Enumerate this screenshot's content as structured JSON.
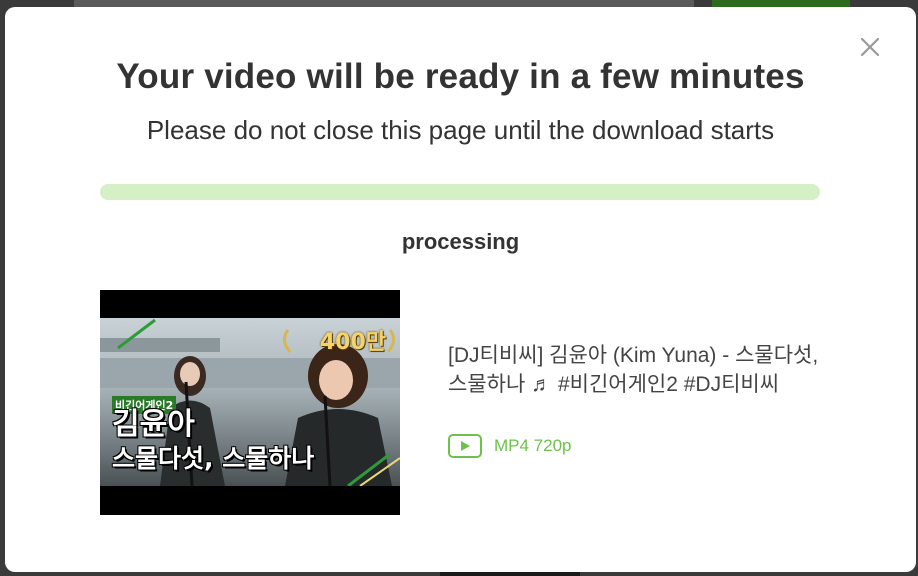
{
  "modal": {
    "title": "Your video will be ready in a few minutes",
    "subtitle": "Please do not close this page until the download starts",
    "status": "processing",
    "close_icon": "close-icon"
  },
  "progress": {
    "fraction": 0.0
  },
  "video": {
    "title": "[DJ티비씨] 김윤아 (Kim Yuna) - 스물다섯, 스물하나 ♬ #비긴어게인2 #DJ티비씨",
    "format": "MP4 720p",
    "thumbnail": {
      "badge": "400만",
      "tag": "비긴어게인2",
      "name": "김윤아",
      "song": "스물다섯, 스물하나"
    }
  },
  "colors": {
    "accent": "#6cc24a",
    "progress_track": "#d5f0c7",
    "text": "#333333"
  },
  "icons": [
    "close-icon",
    "play-icon"
  ]
}
